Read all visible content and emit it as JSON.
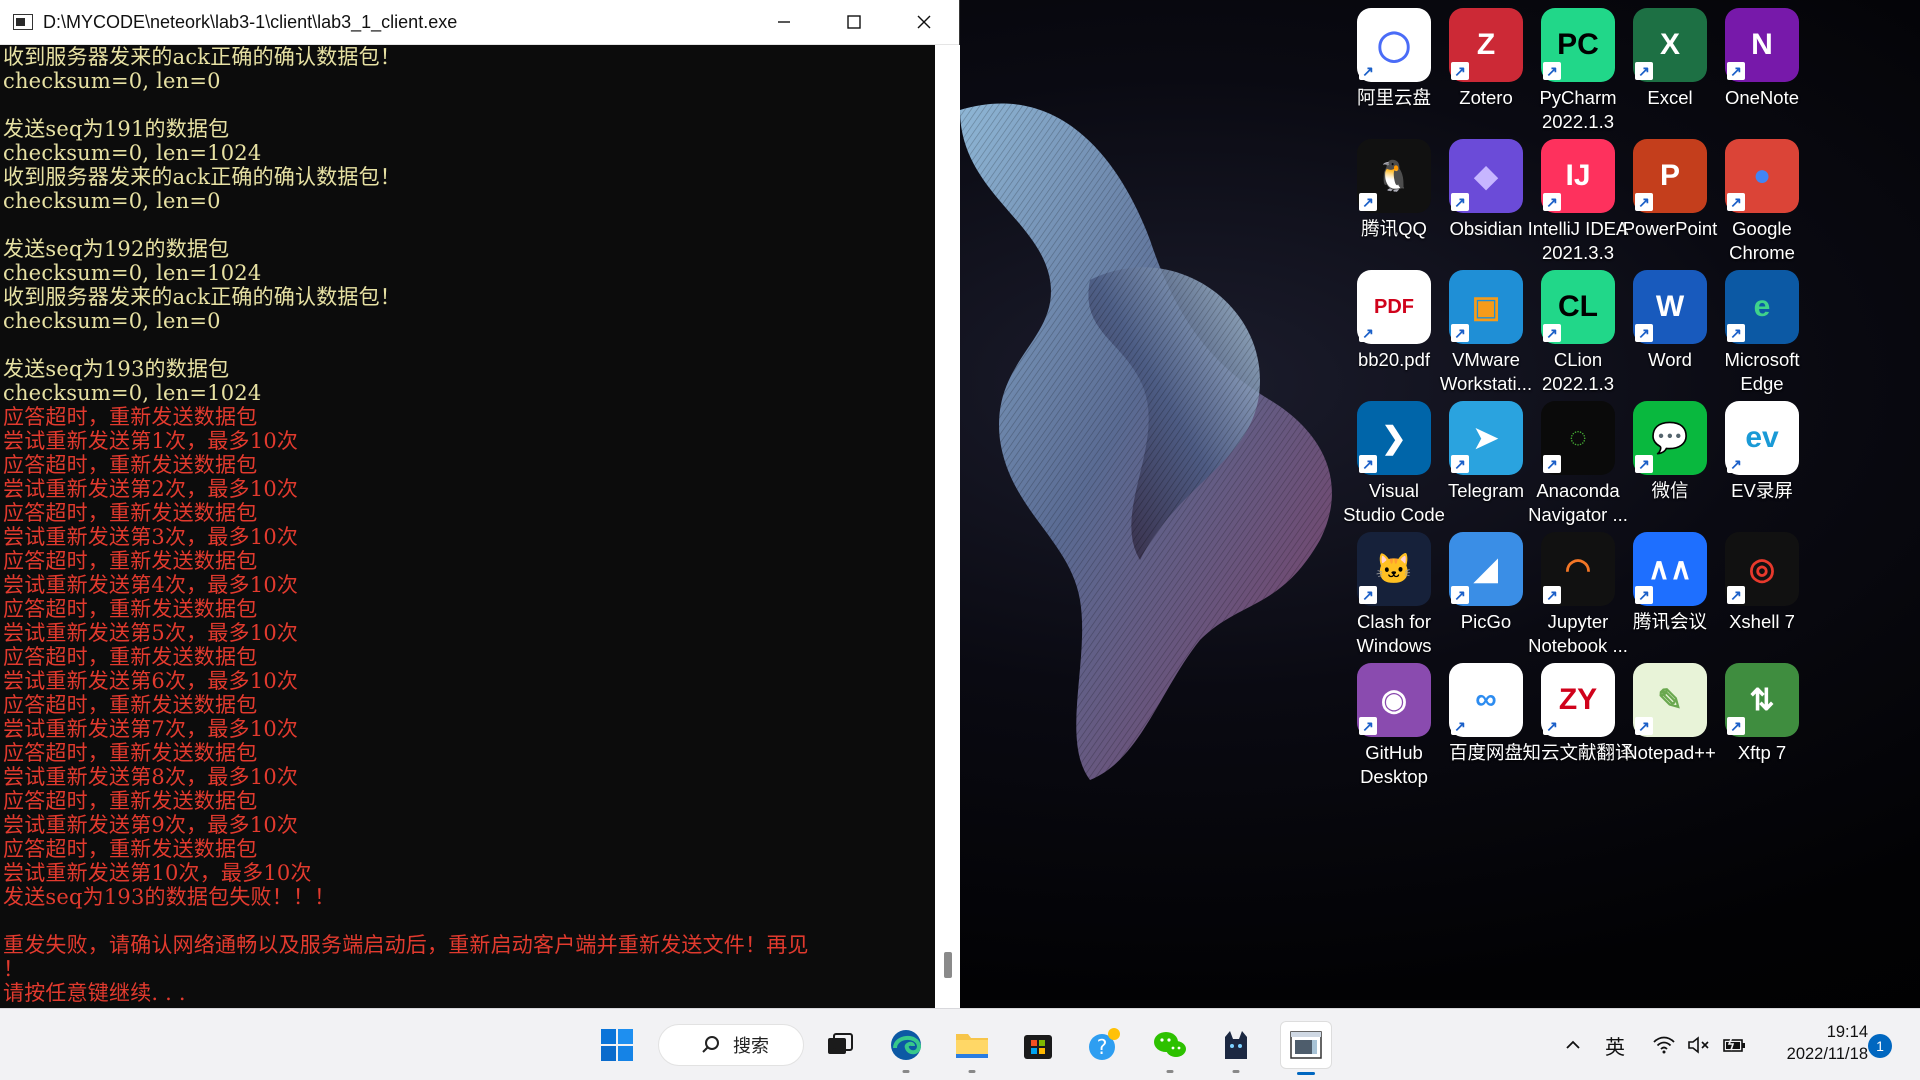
{
  "console": {
    "title": "D:\\MYCODE\\neteork\\lab3-1\\client\\lab3_1_client.exe",
    "lines": [
      {
        "text": "收到服务器发来的ack正确的确认数据包！",
        "color": "yellow"
      },
      {
        "text": "checksum=0, len=0",
        "color": "yellow"
      },
      {
        "text": "",
        "color": "yellow"
      },
      {
        "text": "发送seq为191的数据包",
        "color": "yellow"
      },
      {
        "text": "checksum=0, len=1024",
        "color": "yellow"
      },
      {
        "text": "收到服务器发来的ack正确的确认数据包！",
        "color": "yellow"
      },
      {
        "text": "checksum=0, len=0",
        "color": "yellow"
      },
      {
        "text": "",
        "color": "yellow"
      },
      {
        "text": "发送seq为192的数据包",
        "color": "yellow"
      },
      {
        "text": "checksum=0, len=1024",
        "color": "yellow"
      },
      {
        "text": "收到服务器发来的ack正确的确认数据包！",
        "color": "yellow"
      },
      {
        "text": "checksum=0, len=0",
        "color": "yellow"
      },
      {
        "text": "",
        "color": "yellow"
      },
      {
        "text": "发送seq为193的数据包",
        "color": "yellow"
      },
      {
        "text": "checksum=0, len=1024",
        "color": "yellow"
      },
      {
        "text": "应答超时，重新发送数据包",
        "color": "red"
      },
      {
        "text": "尝试重新发送第1次，最多10次",
        "color": "red"
      },
      {
        "text": "应答超时，重新发送数据包",
        "color": "red"
      },
      {
        "text": "尝试重新发送第2次，最多10次",
        "color": "red"
      },
      {
        "text": "应答超时，重新发送数据包",
        "color": "red"
      },
      {
        "text": "尝试重新发送第3次，最多10次",
        "color": "red"
      },
      {
        "text": "应答超时，重新发送数据包",
        "color": "red"
      },
      {
        "text": "尝试重新发送第4次，最多10次",
        "color": "red"
      },
      {
        "text": "应答超时，重新发送数据包",
        "color": "red"
      },
      {
        "text": "尝试重新发送第5次，最多10次",
        "color": "red"
      },
      {
        "text": "应答超时，重新发送数据包",
        "color": "red"
      },
      {
        "text": "尝试重新发送第6次，最多10次",
        "color": "red"
      },
      {
        "text": "应答超时，重新发送数据包",
        "color": "red"
      },
      {
        "text": "尝试重新发送第7次，最多10次",
        "color": "red"
      },
      {
        "text": "应答超时，重新发送数据包",
        "color": "red"
      },
      {
        "text": "尝试重新发送第8次，最多10次",
        "color": "red"
      },
      {
        "text": "应答超时，重新发送数据包",
        "color": "red"
      },
      {
        "text": "尝试重新发送第9次，最多10次",
        "color": "red"
      },
      {
        "text": "应答超时，重新发送数据包",
        "color": "red"
      },
      {
        "text": "尝试重新发送第10次，最多10次",
        "color": "red"
      },
      {
        "text": "发送seq为193的数据包失败！！！",
        "color": "red"
      },
      {
        "text": "",
        "color": "red"
      },
      {
        "text": "重发失败，请确认网络通畅以及服务端启动后，重新启动客户端并重新发送文件！再见",
        "color": "red"
      },
      {
        "text": "！",
        "color": "red"
      },
      {
        "text": "请按任意键继续. . .",
        "color": "red"
      }
    ]
  },
  "colors": {
    "console_yellow": "#e7e1a3",
    "console_red": "#e23a2e",
    "taskbar_accent": "#0067c0"
  },
  "desktop_icons": [
    {
      "label": "阿里云盘",
      "icon": "aliyun-drive-icon",
      "bg": "#ffffff",
      "glyph": "◯",
      "fg": "#4a6cf7"
    },
    {
      "label": "Zotero",
      "icon": "zotero-icon",
      "bg": "#cc2936",
      "glyph": "Z",
      "fg": "#fff"
    },
    {
      "label": "PyCharm\n2022.1.3",
      "icon": "pycharm-icon",
      "bg": "#21d789",
      "glyph": "PC",
      "fg": "#000"
    },
    {
      "label": "Excel",
      "icon": "excel-icon",
      "bg": "#1d7044",
      "glyph": "X",
      "fg": "#fff"
    },
    {
      "label": "OneNote",
      "icon": "onenote-icon",
      "bg": "#7719aa",
      "glyph": "N",
      "fg": "#fff"
    },
    {
      "label": "腾讯QQ",
      "icon": "qq-icon",
      "bg": "#111111",
      "glyph": "🐧",
      "fg": "#fff"
    },
    {
      "label": "Obsidian",
      "icon": "obsidian-icon",
      "bg": "#6b4bd8",
      "glyph": "◆",
      "fg": "#c7b6ff"
    },
    {
      "label": "IntelliJ IDEA\n2021.3.3",
      "icon": "intellij-icon",
      "bg": "#fe315d",
      "glyph": "IJ",
      "fg": "#fff"
    },
    {
      "label": "PowerPoint",
      "icon": "powerpoint-icon",
      "bg": "#c43e1c",
      "glyph": "P",
      "fg": "#fff"
    },
    {
      "label": "Google\nChrome",
      "icon": "chrome-icon",
      "bg": "#db4437",
      "glyph": "●",
      "fg": "#4285f4"
    },
    {
      "label": "bb20.pdf",
      "icon": "pdf-file-icon",
      "bg": "#ffffff",
      "glyph": "PDF",
      "fg": "#d0021b"
    },
    {
      "label": "VMware\nWorkstati...",
      "icon": "vmware-icon",
      "bg": "#1f8fd6",
      "glyph": "▣",
      "fg": "#f59b1a"
    },
    {
      "label": "CLion\n2022.1.3",
      "icon": "clion-icon",
      "bg": "#21d789",
      "glyph": "CL",
      "fg": "#000"
    },
    {
      "label": "Word",
      "icon": "word-icon",
      "bg": "#185abd",
      "glyph": "W",
      "fg": "#fff"
    },
    {
      "label": "Microsoft\nEdge",
      "icon": "edge-icon",
      "bg": "#0c59a4",
      "glyph": "e",
      "fg": "#3fd28b"
    },
    {
      "label": "Visual\nStudio Code",
      "icon": "vscode-icon",
      "bg": "#0065a9",
      "glyph": "❯",
      "fg": "#fff"
    },
    {
      "label": "Telegram",
      "icon": "telegram-icon",
      "bg": "#2aa3df",
      "glyph": "➤",
      "fg": "#fff"
    },
    {
      "label": "Anaconda\nNavigator ...",
      "icon": "anaconda-icon",
      "bg": "#0a0a0a",
      "glyph": "◌",
      "fg": "#44a833"
    },
    {
      "label": "微信",
      "icon": "wechat-icon",
      "bg": "#09b83e",
      "glyph": "💬",
      "fg": "#fff"
    },
    {
      "label": "EV录屏",
      "icon": "ev-recorder-icon",
      "bg": "#ffffff",
      "glyph": "ev",
      "fg": "#1a9ad6"
    },
    {
      "label": "Clash for\nWindows",
      "icon": "clash-icon",
      "bg": "#16213a",
      "glyph": "🐱",
      "fg": "#fff"
    },
    {
      "label": "PicGo",
      "icon": "picgo-icon",
      "bg": "#3a8ee6",
      "glyph": "◢",
      "fg": "#fff"
    },
    {
      "label": "Jupyter\nNotebook ...",
      "icon": "jupyter-icon",
      "bg": "#111111",
      "glyph": "◠",
      "fg": "#f37626"
    },
    {
      "label": "腾讯会议",
      "icon": "tencent-meeting-icon",
      "bg": "#1e6fff",
      "glyph": "∧∧",
      "fg": "#fff"
    },
    {
      "label": "Xshell 7",
      "icon": "xshell-icon",
      "bg": "#111111",
      "glyph": "◎",
      "fg": "#e8392c"
    },
    {
      "label": "GitHub\nDesktop",
      "icon": "github-desktop-icon",
      "bg": "#8a4baf",
      "glyph": "◉",
      "fg": "#fff"
    },
    {
      "label": "百度网盘",
      "icon": "baidu-netdisk-icon",
      "bg": "#ffffff",
      "glyph": "∞",
      "fg": "#2d8cf0"
    },
    {
      "label": "知云文献翻译",
      "icon": "zhiyun-icon",
      "bg": "#ffffff",
      "glyph": "ZY",
      "fg": "#d0021b"
    },
    {
      "label": "Notepad++",
      "icon": "notepad-plus-plus-icon",
      "bg": "#e8f3d8",
      "glyph": "✎",
      "fg": "#6aa84f"
    },
    {
      "label": "Xftp 7",
      "icon": "xftp-icon",
      "bg": "#3f8d3f",
      "glyph": "⇅",
      "fg": "#fff"
    }
  ],
  "taskbar": {
    "search_label": "搜索",
    "apps": [
      {
        "name": "start-button",
        "icon": "windows-start-icon",
        "dot": false,
        "active": false
      },
      {
        "name": "task-view-button",
        "icon": "task-view-icon",
        "dot": false,
        "active": false
      },
      {
        "name": "taskbar-edge",
        "icon": "edge-icon",
        "dot": true,
        "active": false
      },
      {
        "name": "taskbar-file-explorer",
        "icon": "folder-icon",
        "dot": true,
        "active": false
      },
      {
        "name": "taskbar-store",
        "icon": "store-icon",
        "dot": false,
        "active": false
      },
      {
        "name": "taskbar-qq",
        "icon": "qq-icon",
        "dot": false,
        "active": false
      },
      {
        "name": "taskbar-wechat",
        "icon": "wechat-icon",
        "dot": true,
        "active": false
      },
      {
        "name": "taskbar-clash",
        "icon": "clash-icon",
        "dot": true,
        "active": false
      },
      {
        "name": "taskbar-console",
        "icon": "console-icon",
        "dot": true,
        "active": true
      }
    ],
    "tray": {
      "ime": "英",
      "time": "19:14",
      "date": "2022/11/18",
      "notifications": "1"
    }
  }
}
